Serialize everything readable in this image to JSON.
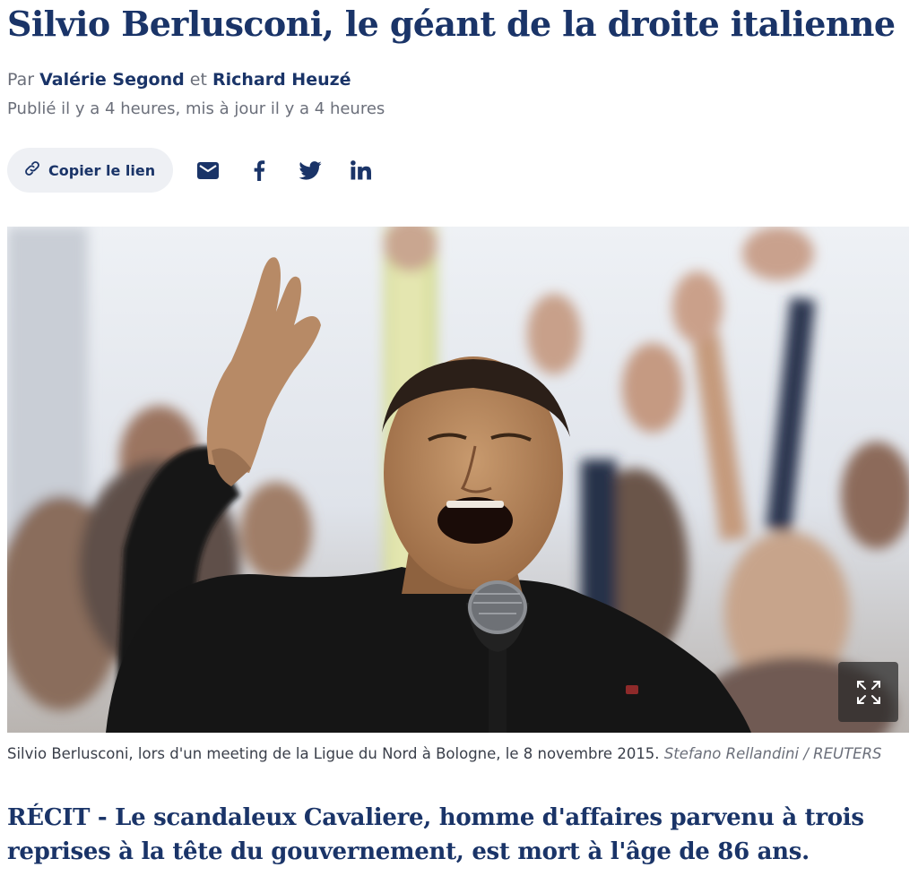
{
  "article": {
    "title": "Silvio Berlusconi, le géant de la droite italienne",
    "byline": {
      "prefix": "Par",
      "author1": "Valérie Segond",
      "connector": "et",
      "author2": "Richard Heuzé"
    },
    "dates": "Publié il y a 4 heures, mis à jour il y a 4 heures",
    "lead": "RÉCIT - Le scandaleux Cavaliere, homme d'affaires parvenu à trois reprises à la tête du gouvernement, est mort à l'âge de 86 ans."
  },
  "share": {
    "copy_label": "Copier le lien",
    "icons": [
      "link-icon",
      "mail-icon",
      "facebook-icon",
      "twitter-icon",
      "linkedin-icon"
    ]
  },
  "photo": {
    "caption": "Silvio Berlusconi, lors d'un meeting de la Ligue du Nord à Bologne, le 8 novembre 2015.",
    "credit": "Stefano Rellandini / REUTERS",
    "expand_icon": "expand-icon"
  },
  "colors": {
    "title": "#1a3468",
    "meta": "#6b6f7a",
    "button_bg": "#eef0f4"
  }
}
